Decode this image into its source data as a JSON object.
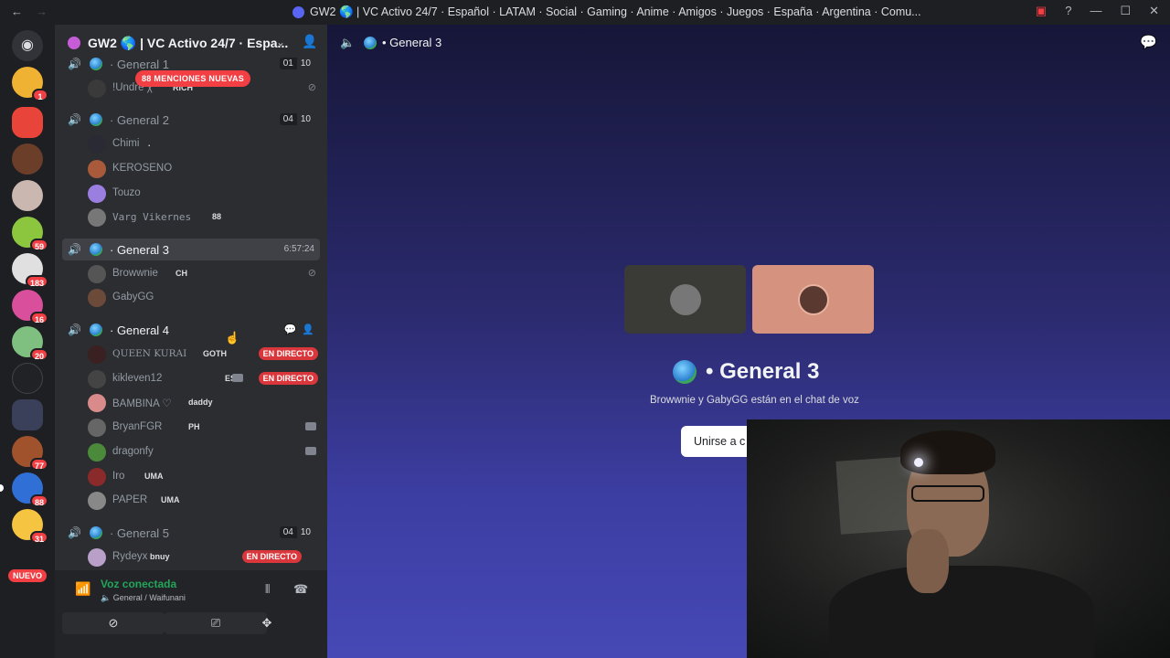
{
  "window": {
    "title": "GW2 🌎 | VC Activo 24/7 · Español · LATAM · Social · Gaming · Anime · Amigos · Juegos · España · Argentina · Comu..."
  },
  "server_rail": {
    "badges": [
      "1",
      "59",
      "183",
      "16",
      "20",
      "77",
      "88",
      "31"
    ],
    "nuevo_label": "NUEVO"
  },
  "guild": {
    "name": "GW2 🌎 | VC Activo 24/7 · Espa...",
    "mentions_pill": "88 MENCIONES NUEVAS"
  },
  "channels": [
    {
      "name": "· General 1",
      "count_a": "01",
      "count_b": "10"
    },
    {
      "name": "· General 2",
      "count_a": "04",
      "count_b": "10"
    },
    {
      "name": "· General 3",
      "timer": "6:57:24"
    },
    {
      "name": "· General 4"
    },
    {
      "name": "· General 5",
      "count_a": "04",
      "count_b": "10"
    }
  ],
  "users": {
    "g1": [
      {
        "name": "!Undre χ",
        "tag": "RICH"
      }
    ],
    "g2": [
      {
        "name": "Chimi",
        "tag": "."
      },
      {
        "name": "KEROSENO",
        "tag": ""
      },
      {
        "name": "Touzo",
        "tag": ""
      },
      {
        "name": "Varg Vikernes",
        "tag": "88"
      }
    ],
    "g3": [
      {
        "name": "Browwnie",
        "tag": "CH"
      },
      {
        "name": "GabyGG",
        "tag": ""
      }
    ],
    "g4": [
      {
        "name": "QUEEN KURAI",
        "tag": "GOTH"
      },
      {
        "name": "kikleven12",
        "tag": "ESP"
      },
      {
        "name": "BAMBINA ♡",
        "tag": "daddy"
      },
      {
        "name": "BryanFGR",
        "tag": "PH"
      },
      {
        "name": "dragonfy",
        "tag": ""
      },
      {
        "name": "Iro",
        "tag": "UMA"
      },
      {
        "name": "PAPER",
        "tag": "UMA"
      }
    ],
    "g5": [
      {
        "name": "Rydeyx",
        "tag": "bnuy"
      }
    ]
  },
  "live_label": "EN DIRECTO",
  "voice_panel": {
    "status": "Voz conectada",
    "channel": "General / Waifunani"
  },
  "main": {
    "header_title": "• General 3",
    "big_title": "• General 3",
    "subtitle": "Browwnie y GabyGG están en el chat de voz",
    "join_label": "Unirse a c"
  },
  "colors": {
    "online": "#23a55a",
    "live": "#da373c",
    "accent_gradient_top": "#161638",
    "accent_gradient_bottom": "#4648b5"
  }
}
